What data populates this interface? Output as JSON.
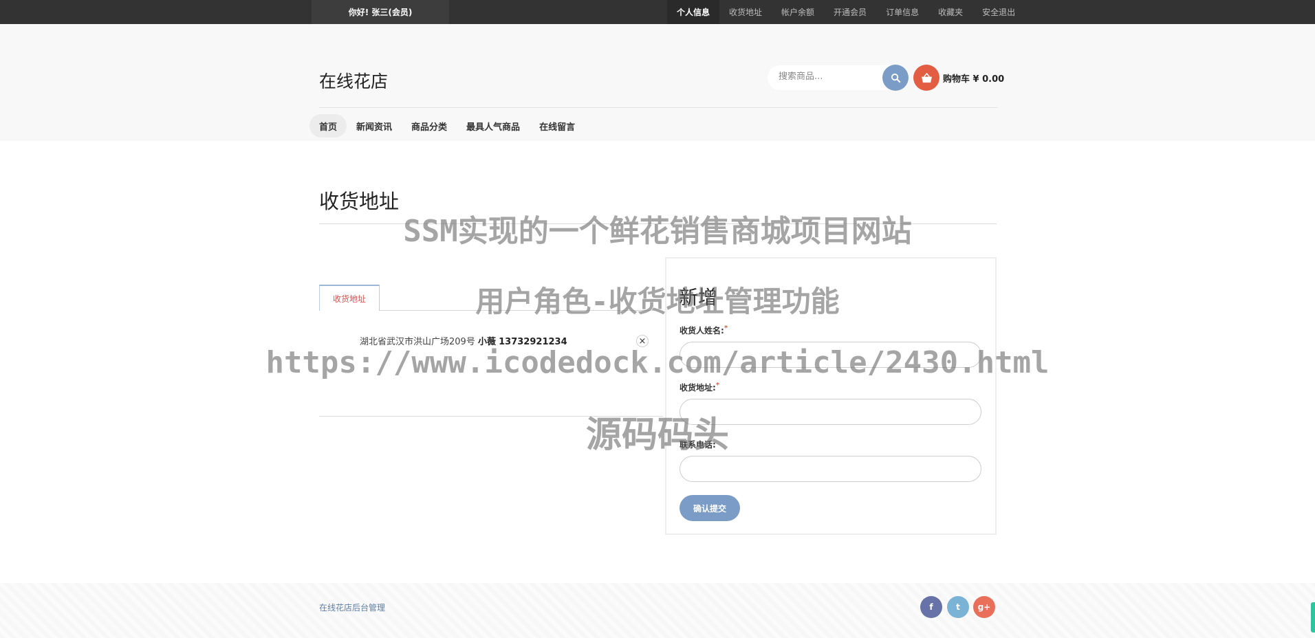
{
  "topbar": {
    "greeting": "你好!  张三(会员)",
    "nav": [
      {
        "label": "个人信息",
        "active": true
      },
      {
        "label": "收货地址",
        "active": false
      },
      {
        "label": "帐户余额",
        "active": false
      },
      {
        "label": "开通会员",
        "active": false
      },
      {
        "label": "订单信息",
        "active": false
      },
      {
        "label": "收藏夹",
        "active": false
      },
      {
        "label": "安全退出",
        "active": false
      }
    ]
  },
  "header": {
    "logo": "在线花店",
    "search_placeholder": "搜索商品...",
    "search_icon": "search-icon",
    "cart_icon": "basket-icon",
    "cart_label": "购物车 ¥ 0.00"
  },
  "mainnav": [
    {
      "label": "首页",
      "active": true
    },
    {
      "label": "新闻资讯",
      "active": false
    },
    {
      "label": "商品分类",
      "active": false
    },
    {
      "label": "最具人气商品",
      "active": false
    },
    {
      "label": "在线留言",
      "active": false
    }
  ],
  "page": {
    "title": "收货地址",
    "tab_label": "收货地址",
    "address": {
      "text": "湖北省武汉市洪山广场209号",
      "name": "小薇",
      "phone": "13732921234"
    },
    "close_glyph": "×"
  },
  "form": {
    "title": "新增",
    "name_label": "收货人姓名:",
    "address_label": "收货地址:",
    "phone_label": "联系电话:",
    "required_mark": "*",
    "submit_label": "确认提交"
  },
  "watermark": {
    "line1": "SSM实现的一个鲜花销售商城项目网站",
    "line2": "用户角色-收货地址管理功能",
    "line3": "https://www.icodedock.com/article/2430.html",
    "line4": "源码码头"
  },
  "footer": {
    "link": "在线花店后台管理",
    "social": [
      {
        "icon": "facebook-icon",
        "glyph": "f"
      },
      {
        "icon": "twitter-icon",
        "glyph": "t"
      },
      {
        "icon": "google-plus-icon",
        "glyph": "g+"
      }
    ]
  }
}
